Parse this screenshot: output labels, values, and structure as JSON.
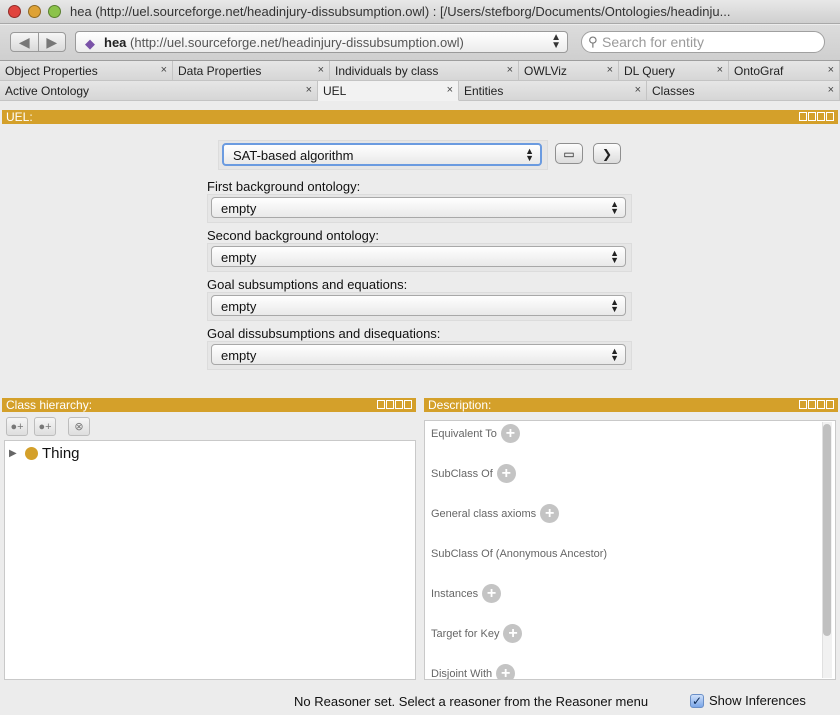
{
  "window": {
    "title": "hea (http://uel.sourceforge.net/headinjury-dissubsumption.owl)  : [/Users/stefborg/Documents/Ontologies/headinju..."
  },
  "toolbar": {
    "ontology_name": "hea",
    "ontology_iri": "(http://uel.sourceforge.net/headinjury-dissubsumption.owl)",
    "search_placeholder": "Search for entity"
  },
  "tabs_row1": [
    {
      "label": "Object Properties"
    },
    {
      "label": "Data Properties"
    },
    {
      "label": "Individuals by class"
    },
    {
      "label": "OWLViz"
    },
    {
      "label": "DL Query"
    },
    {
      "label": "OntoGraf"
    }
  ],
  "tabs_row2": [
    {
      "label": "Active Ontology"
    },
    {
      "label": "UEL",
      "active": true
    },
    {
      "label": "Entities"
    },
    {
      "label": "Classes"
    }
  ],
  "uel": {
    "title": "UEL:",
    "algorithm": "SAT-based algorithm",
    "fields": [
      {
        "label": "First background ontology:",
        "value": "empty"
      },
      {
        "label": "Second background ontology:",
        "value": "empty"
      },
      {
        "label": "Goal subsumptions and equations:",
        "value": "empty"
      },
      {
        "label": "Goal dissubsumptions and disequations:",
        "value": "empty"
      }
    ]
  },
  "class_hierarchy": {
    "title": "Class hierarchy:",
    "root": "Thing"
  },
  "description": {
    "title": "Description:",
    "sections": [
      {
        "label": "Equivalent To",
        "addable": true
      },
      {
        "label": "SubClass Of",
        "addable": true
      },
      {
        "label": "General class axioms",
        "addable": true
      },
      {
        "label": "SubClass Of (Anonymous Ancestor)",
        "addable": false
      },
      {
        "label": "Instances",
        "addable": true
      },
      {
        "label": "Target for Key",
        "addable": true
      },
      {
        "label": "Disjoint With",
        "addable": true
      }
    ]
  },
  "status": {
    "message": "No Reasoner set. Select a reasoner from the Reasoner menu",
    "show_inferences_label": "Show Inferences",
    "show_inferences_checked": true
  },
  "colors": {
    "view_header": "#d4a02a",
    "thing_icon": "#d4a02a"
  }
}
